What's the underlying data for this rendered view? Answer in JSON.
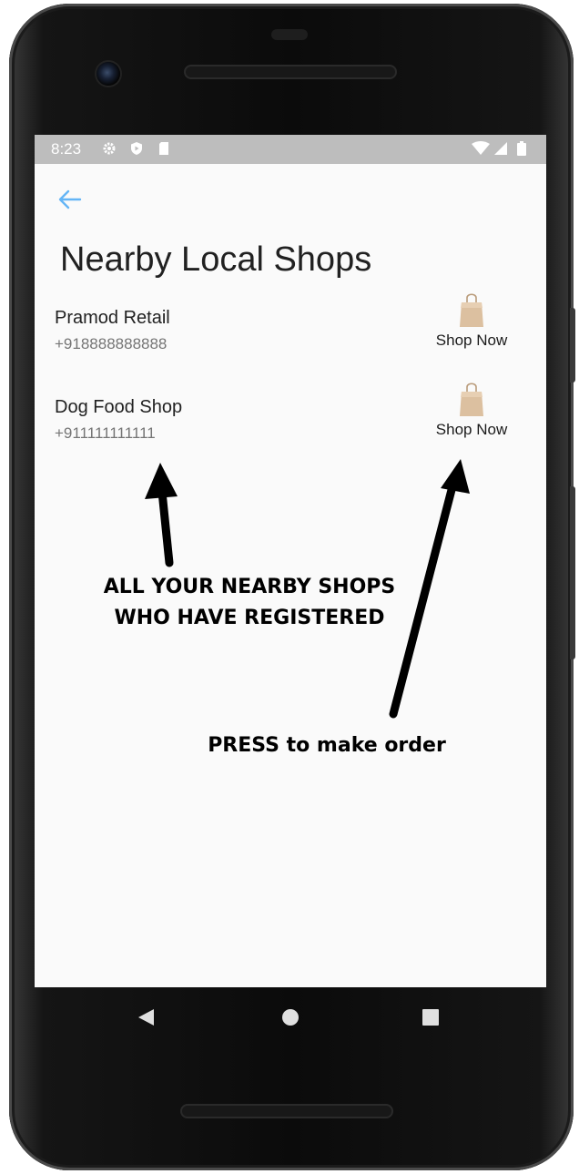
{
  "status_bar": {
    "time": "8:23",
    "left_icons": [
      "gear-icon",
      "shield-icon",
      "sd-card-icon"
    ],
    "right_icons": [
      "wifi-icon",
      "signal-icon",
      "battery-icon"
    ]
  },
  "toolbar": {
    "back_icon": "arrow-left-icon",
    "accent_color": "#64b5f6"
  },
  "page": {
    "title": "Nearby Local Shops"
  },
  "shops": [
    {
      "name": "Pramod Retail",
      "phone": "+918888888888",
      "button_label": "Shop Now",
      "button_icon": "shopping-bag-icon"
    },
    {
      "name": "Dog Food Shop",
      "phone": "+911111111111",
      "button_label": "Shop Now",
      "button_icon": "shopping-bag-icon"
    }
  ],
  "annotations": {
    "shops_note_line1": "ALL YOUR NEARBY SHOPS",
    "shops_note_line2": "WHO HAVE REGISTERED",
    "order_note": "PRESS to make order"
  },
  "nav": {
    "back_icon": "triangle-back-icon",
    "home_icon": "circle-home-icon",
    "recents_icon": "square-recents-icon"
  }
}
